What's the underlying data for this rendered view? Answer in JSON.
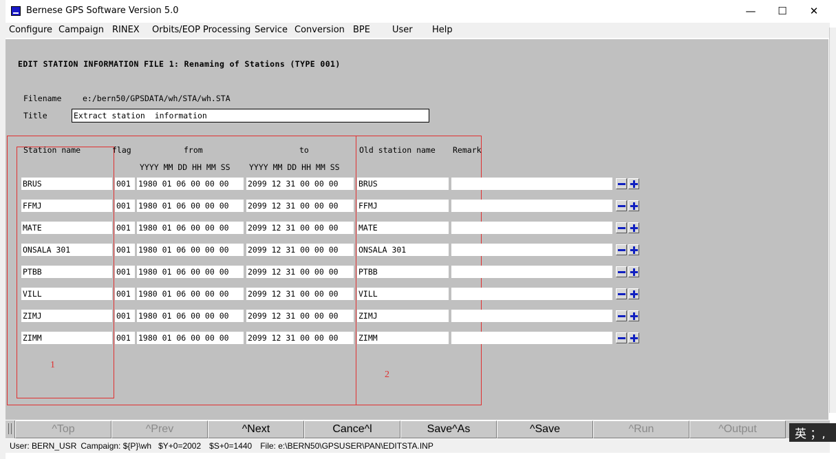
{
  "window": {
    "title": "Bernese GPS Software Version 5.0",
    "controls": {
      "minimize": "—",
      "maximize": "☐",
      "close": "✕"
    }
  },
  "menu": [
    "Configure",
    "Campaign",
    "RINEX",
    "Orbits/EOP",
    "Processing",
    "Service",
    "Conversion",
    "BPE",
    "User",
    "Help"
  ],
  "panel": {
    "heading": "EDIT STATION INFORMATION FILE 1: Renaming of Stations (TYPE 001)",
    "filename_label": "Filename",
    "filename_value": "e:/bern50/GPSDATA/wh/STA/wh.STA",
    "title_label": "Title",
    "title_value": "Extract station  information"
  },
  "table": {
    "headers": {
      "station_name": "Station name",
      "flag": "flag",
      "from": "from",
      "to": "to",
      "old_station_name": "Old station name",
      "remark": "Remark",
      "from_units": "YYYY MM DD HH MM SS",
      "to_units": "YYYY MM DD HH MM SS"
    },
    "rows": [
      {
        "station": "BRUS",
        "flag": "001",
        "from": "1980 01 06 00 00 00",
        "to": "2099 12 31 00 00 00",
        "old": "BRUS",
        "remark": ""
      },
      {
        "station": "FFMJ",
        "flag": "001",
        "from": "1980 01 06 00 00 00",
        "to": "2099 12 31 00 00 00",
        "old": "FFMJ",
        "remark": ""
      },
      {
        "station": "MATE",
        "flag": "001",
        "from": "1980 01 06 00 00 00",
        "to": "2099 12 31 00 00 00",
        "old": "MATE",
        "remark": ""
      },
      {
        "station": "ONSALA 301",
        "flag": "001",
        "from": "1980 01 06 00 00 00",
        "to": "2099 12 31 00 00 00",
        "old": "ONSALA 301",
        "remark": ""
      },
      {
        "station": "PTBB",
        "flag": "001",
        "from": "1980 01 06 00 00 00",
        "to": "2099 12 31 00 00 00",
        "old": "PTBB",
        "remark": ""
      },
      {
        "station": "VILL",
        "flag": "001",
        "from": "1980 01 06 00 00 00",
        "to": "2099 12 31 00 00 00",
        "old": "VILL",
        "remark": ""
      },
      {
        "station": "ZIMJ",
        "flag": "001",
        "from": "1980 01 06 00 00 00",
        "to": "2099 12 31 00 00 00",
        "old": "ZIMJ",
        "remark": ""
      },
      {
        "station": "ZIMM",
        "flag": "001",
        "from": "1980 01 06 00 00 00",
        "to": "2099 12 31 00 00 00",
        "old": "ZIMM",
        "remark": ""
      }
    ]
  },
  "annotations": {
    "box1": "1",
    "box2": "2",
    "color": "#e03030"
  },
  "nav": [
    "^Top",
    "^Prev",
    "^Next",
    "Cance^l",
    "Save^As",
    "^Save",
    "^Run",
    "^Output"
  ],
  "nav_disabled": [
    true,
    true,
    false,
    false,
    false,
    false,
    true,
    true
  ],
  "status": {
    "user": "User: BERN_USR",
    "campaign": "Campaign: ${P}\\wh",
    "year": "$Y+0=2002",
    "session": "$S+0=1440",
    "file": "File: e:\\BERN50\\GPSUSER\\PAN\\EDITSTA.INP"
  },
  "ime": "英 ；,"
}
